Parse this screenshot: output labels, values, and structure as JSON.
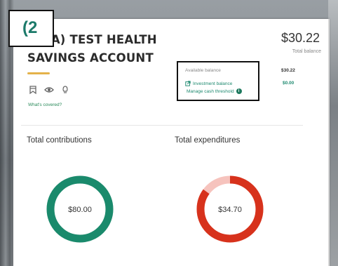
{
  "step_marker": "(2",
  "account": {
    "title_line1": "(HSA) TEST HEALTH",
    "title_line2": "SAVINGS ACCOUNT",
    "total_amount": "$30.22",
    "total_label": "Total balance",
    "whats_covered": "What's covered?"
  },
  "balances": {
    "available_label": "Available balance",
    "available_value": "$30.22",
    "investment_label": "Investment balance",
    "investment_value": "$0.00",
    "threshold_link": "Manage cash threshold",
    "info_glyph": "i"
  },
  "contributions": {
    "title": "Total contributions",
    "value": "$80.00",
    "fraction": 1.0,
    "color": "#1a8a6c"
  },
  "expenditures": {
    "title": "Total expenditures",
    "value": "$34.70",
    "fraction": 0.85,
    "color": "#d7321c",
    "remainder_color": "#f6c3bd"
  },
  "icons": [
    "bookmark-icon",
    "eye-icon",
    "lightbulb-icon",
    "external-link-icon",
    "info-icon"
  ]
}
